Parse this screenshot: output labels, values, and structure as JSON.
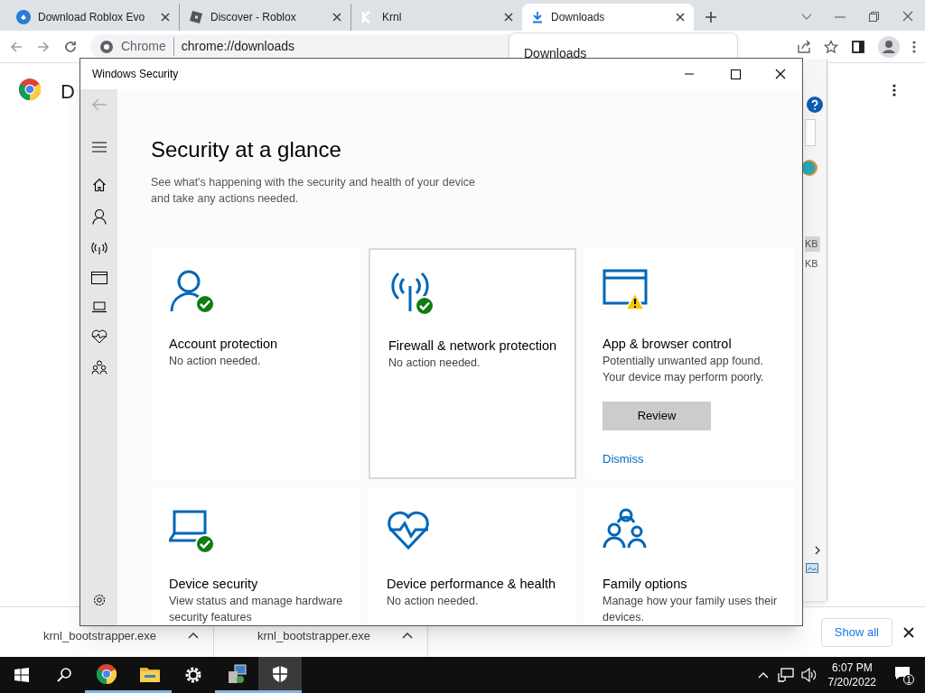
{
  "browser": {
    "tabs": [
      {
        "label": "Download Roblox Evo",
        "kind": "site",
        "selected": false
      },
      {
        "label": "Discover - Roblox",
        "kind": "roblox",
        "selected": false
      },
      {
        "label": "Krnl",
        "kind": "krnl",
        "selected": false
      },
      {
        "label": "Downloads",
        "kind": "download",
        "selected": true
      }
    ],
    "site_chip": "Chrome",
    "address": "chrome://downloads",
    "popup_title": "Downloads",
    "page_title_fragment": "D"
  },
  "background_window": {
    "size_labels": [
      "KB",
      "KB"
    ]
  },
  "security_window": {
    "title": "Windows Security",
    "heading": "Security at a glance",
    "intro": "See what's happening with the security and health of your device and take any actions needed.",
    "cards": [
      {
        "kind": "account",
        "checked": true,
        "warning": false,
        "highlighted": false,
        "title": "Account protection",
        "description": "No action needed."
      },
      {
        "kind": "firewall",
        "checked": true,
        "warning": false,
        "highlighted": true,
        "title": "Firewall & network protection",
        "description": "No action needed."
      },
      {
        "kind": "browser",
        "checked": false,
        "warning": true,
        "highlighted": false,
        "title": "App & browser control",
        "description": "Potentially unwanted app found. Your device may perform poorly.",
        "button": "Review",
        "link": "Dismiss"
      },
      {
        "kind": "device",
        "checked": true,
        "warning": false,
        "highlighted": false,
        "title": "Device security",
        "description": "View status and manage hardware security features"
      },
      {
        "kind": "performance",
        "checked": false,
        "warning": false,
        "highlighted": false,
        "title": "Device performance & health",
        "description": "No action needed."
      },
      {
        "kind": "family",
        "checked": false,
        "warning": false,
        "highlighted": false,
        "title": "Family options",
        "description": "Manage how your family uses their devices."
      }
    ]
  },
  "download_bar": {
    "items": [
      "krnl_bootstrapper.exe",
      "krnl_bootstrapper.exe"
    ],
    "show_all": "Show all"
  },
  "taskbar": {
    "apps": [
      {
        "kind": "chrome",
        "running": true,
        "selected": false
      },
      {
        "kind": "folder",
        "running": true,
        "selected": false
      },
      {
        "kind": "settings",
        "running": false,
        "selected": false
      },
      {
        "kind": "installer",
        "running": true,
        "selected": false
      },
      {
        "kind": "shield",
        "running": true,
        "selected": true
      }
    ],
    "time": "6:07 PM",
    "date": "7/20/2022",
    "notification_count": "1"
  }
}
